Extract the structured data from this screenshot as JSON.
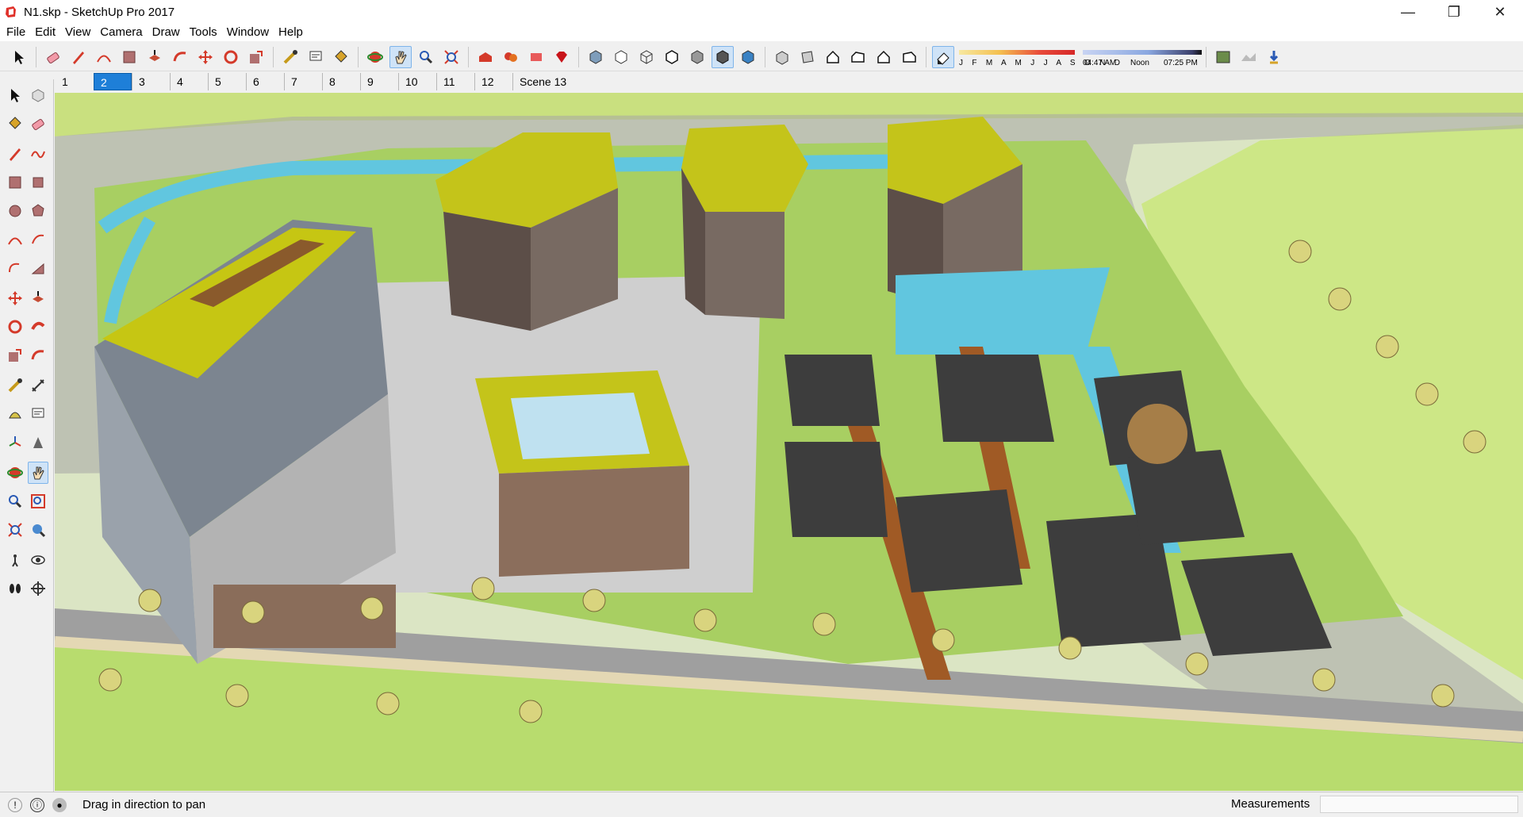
{
  "window": {
    "title": "N1.skp - SketchUp Pro 2017",
    "minimize": "—",
    "maximize": "❐",
    "close": "✕"
  },
  "menu": [
    "File",
    "Edit",
    "View",
    "Camera",
    "Draw",
    "Tools",
    "Window",
    "Help"
  ],
  "toolbar": {
    "months_label": "J F M A M J J A S O N D",
    "time_start": "04:47 AM",
    "time_mid": "Noon",
    "time_end": "07:25 PM"
  },
  "scenes": {
    "tabs": [
      "1",
      "2",
      "3",
      "4",
      "5",
      "6",
      "7",
      "8",
      "9",
      "10",
      "11",
      "12",
      "Scene 13"
    ],
    "active": "2"
  },
  "status": {
    "message": "Drag in direction to pan",
    "measurements_label": "Measurements",
    "measurements_value": ""
  },
  "colors": {
    "accent": "#1e7fd8",
    "roof_yellow": "#c8c81a",
    "lawn_green": "#a6cf63",
    "road_grey": "#a3a3a3",
    "water_cyan": "#54c3dc"
  }
}
